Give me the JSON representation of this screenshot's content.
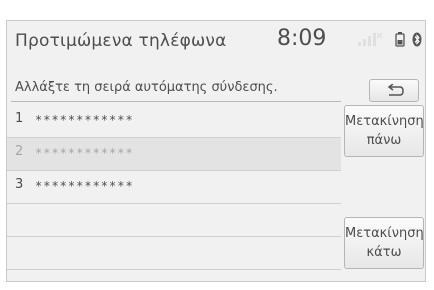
{
  "header": {
    "title": "Προτιμώμενα τηλέφωνα",
    "clock": "8:09",
    "status_icons": [
      "signal-icon",
      "battery-icon",
      "bluetooth-icon"
    ]
  },
  "subtitle": "Αλλάξτε τη σειρά αυτόματης σύνδεσης.",
  "back_button": {
    "icon": "back-arrow-icon"
  },
  "phones": [
    {
      "number": "1",
      "name": "************",
      "selected": false
    },
    {
      "number": "2",
      "name": "************",
      "selected": true
    },
    {
      "number": "3",
      "name": "************",
      "selected": false
    }
  ],
  "buttons": {
    "move_up": {
      "line1": "Μετακίνηση",
      "line2": "πάνω"
    },
    "move_down": {
      "line1": "Μετακίνηση",
      "line2": "κάτω"
    }
  },
  "colors": {
    "background": "#f1f1f1",
    "text": "#4d4d4d",
    "selected_row": "#e3e3e3",
    "dimmed_text": "#a6a6a6"
  }
}
